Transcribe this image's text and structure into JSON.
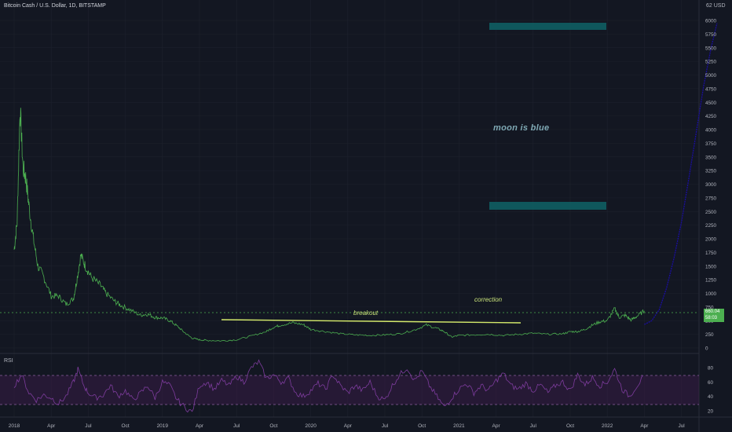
{
  "header": {
    "title": "Bitcoin Cash / U.S. Dollar, 1D, BITSTAMP",
    "currency": "USD",
    "currency_prefix": "62"
  },
  "indicator": {
    "label": "RSI"
  },
  "last_price": {
    "value": "660.04",
    "sub": "58:03"
  },
  "notes": {
    "moon": "moon is blue",
    "breakout": "breakout",
    "correction": "correction"
  },
  "colors": {
    "background": "#131722",
    "price": "#4caf50",
    "rsi": "#7e3c9e",
    "projection": "#1a0ea0",
    "trendline": "#d4ea6b",
    "target_box": "#0f5e63"
  },
  "chart_data": [
    {
      "type": "line",
      "name": "price",
      "x_ticks": [
        "2018",
        "Apr",
        "Jul",
        "Oct",
        "2019",
        "Apr",
        "Jul",
        "Oct",
        "2020",
        "Apr",
        "Jul",
        "Oct",
        "2021",
        "Apr",
        "Jul",
        "Oct",
        "2022",
        "Apr",
        "Jul"
      ],
      "y_ticks": [
        "6000",
        "5750",
        "5500",
        "5250",
        "5000",
        "4750",
        "4500",
        "4250",
        "4000",
        "3750",
        "3500",
        "3250",
        "3000",
        "2750",
        "2500",
        "2250",
        "2000",
        "1750",
        "1500",
        "1250",
        "1000",
        "750",
        "500",
        "250",
        "0"
      ],
      "ylim": [
        0,
        6200
      ],
      "series": [
        {
          "values": [
            [
              0,
              1800
            ],
            [
              0.02,
              2300
            ],
            [
              0.04,
              4400
            ],
            [
              0.06,
              3300
            ],
            [
              0.08,
              3100
            ],
            [
              0.1,
              2600
            ],
            [
              0.13,
              2000
            ],
            [
              0.16,
              1500
            ],
            [
              0.2,
              1300
            ],
            [
              0.25,
              950
            ],
            [
              0.3,
              950
            ],
            [
              0.35,
              800
            ],
            [
              0.4,
              900
            ],
            [
              0.42,
              1200
            ],
            [
              0.45,
              1700
            ],
            [
              0.48,
              1500
            ],
            [
              0.52,
              1300
            ],
            [
              0.58,
              1150
            ],
            [
              0.62,
              1000
            ],
            [
              0.68,
              850
            ],
            [
              0.72,
              780
            ],
            [
              0.78,
              700
            ],
            [
              0.85,
              600
            ],
            [
              0.9,
              620
            ],
            [
              0.95,
              560
            ],
            [
              1.0,
              550
            ],
            [
              1.05,
              500
            ],
            [
              1.1,
              400
            ],
            [
              1.15,
              280
            ],
            [
              1.2,
              180
            ],
            [
              1.25,
              150
            ],
            [
              1.3,
              140
            ],
            [
              1.4,
              130
            ],
            [
              1.5,
              150
            ],
            [
              1.6,
              220
            ],
            [
              1.7,
              300
            ],
            [
              1.75,
              380
            ],
            [
              1.8,
              420
            ],
            [
              1.88,
              460
            ],
            [
              1.95,
              430
            ],
            [
              2.0,
              340
            ],
            [
              2.1,
              300
            ],
            [
              2.2,
              260
            ],
            [
              2.3,
              240
            ],
            [
              2.4,
              230
            ],
            [
              2.5,
              240
            ],
            [
              2.6,
              260
            ],
            [
              2.7,
              330
            ],
            [
              2.78,
              420
            ],
            [
              2.85,
              360
            ],
            [
              2.9,
              300
            ],
            [
              2.95,
              200
            ],
            [
              3.0,
              230
            ],
            [
              3.1,
              240
            ],
            [
              3.2,
              250
            ],
            [
              3.3,
              230
            ],
            [
              3.4,
              250
            ],
            [
              3.5,
              270
            ],
            [
              3.6,
              250
            ],
            [
              3.7,
              260
            ],
            [
              3.75,
              300
            ],
            [
              3.8,
              300
            ],
            [
              3.85,
              340
            ],
            [
              3.9,
              420
            ],
            [
              3.95,
              480
            ],
            [
              4.0,
              500
            ],
            [
              4.05,
              720
            ],
            [
              4.08,
              560
            ],
            [
              4.12,
              600
            ],
            [
              4.16,
              510
            ],
            [
              4.2,
              580
            ],
            [
              4.25,
              680
            ]
          ]
        }
      ]
    },
    {
      "type": "line",
      "name": "projection",
      "series": [
        {
          "values": [
            [
              4.25,
              430
            ],
            [
              4.3,
              500
            ],
            [
              4.35,
              700
            ],
            [
              4.4,
              1100
            ],
            [
              4.45,
              1650
            ],
            [
              4.5,
              2300
            ],
            [
              4.55,
              3100
            ],
            [
              4.6,
              3950
            ],
            [
              4.65,
              4800
            ],
            [
              4.7,
              5500
            ],
            [
              4.74,
              5950
            ]
          ]
        }
      ]
    },
    {
      "type": "line",
      "name": "RSI",
      "y_ticks": [
        "80",
        "60",
        "40",
        "20"
      ],
      "ylim": [
        15,
        95
      ],
      "bands": [
        30,
        70
      ],
      "series": [
        {
          "values": [
            [
              0,
              55
            ],
            [
              0.05,
              70
            ],
            [
              0.1,
              45
            ],
            [
              0.15,
              35
            ],
            [
              0.2,
              42
            ],
            [
              0.25,
              38
            ],
            [
              0.3,
              30
            ],
            [
              0.35,
              40
            ],
            [
              0.4,
              60
            ],
            [
              0.43,
              78
            ],
            [
              0.47,
              55
            ],
            [
              0.5,
              45
            ],
            [
              0.55,
              38
            ],
            [
              0.6,
              42
            ],
            [
              0.65,
              55
            ],
            [
              0.7,
              40
            ],
            [
              0.75,
              48
            ],
            [
              0.8,
              35
            ],
            [
              0.85,
              44
            ],
            [
              0.9,
              55
            ],
            [
              0.95,
              38
            ],
            [
              1.0,
              60
            ],
            [
              1.05,
              55
            ],
            [
              1.1,
              35
            ],
            [
              1.15,
              25
            ],
            [
              1.2,
              18
            ],
            [
              1.25,
              55
            ],
            [
              1.3,
              60
            ],
            [
              1.35,
              50
            ],
            [
              1.4,
              62
            ],
            [
              1.45,
              55
            ],
            [
              1.5,
              68
            ],
            [
              1.55,
              60
            ],
            [
              1.6,
              80
            ],
            [
              1.65,
              88
            ],
            [
              1.7,
              65
            ],
            [
              1.75,
              70
            ],
            [
              1.8,
              60
            ],
            [
              1.85,
              65
            ],
            [
              1.9,
              45
            ],
            [
              1.95,
              40
            ],
            [
              2.0,
              48
            ],
            [
              2.05,
              58
            ],
            [
              2.1,
              50
            ],
            [
              2.15,
              70
            ],
            [
              2.2,
              55
            ],
            [
              2.25,
              45
            ],
            [
              2.3,
              55
            ],
            [
              2.35,
              48
            ],
            [
              2.4,
              60
            ],
            [
              2.45,
              40
            ],
            [
              2.5,
              35
            ],
            [
              2.55,
              55
            ],
            [
              2.6,
              70
            ],
            [
              2.65,
              80
            ],
            [
              2.7,
              62
            ],
            [
              2.75,
              75
            ],
            [
              2.8,
              55
            ],
            [
              2.85,
              40
            ],
            [
              2.9,
              25
            ],
            [
              2.95,
              38
            ],
            [
              3.0,
              50
            ],
            [
              3.05,
              58
            ],
            [
              3.1,
              45
            ],
            [
              3.15,
              55
            ],
            [
              3.2,
              48
            ],
            [
              3.25,
              62
            ],
            [
              3.3,
              72
            ],
            [
              3.35,
              55
            ],
            [
              3.4,
              50
            ],
            [
              3.45,
              58
            ],
            [
              3.5,
              48
            ],
            [
              3.55,
              56
            ],
            [
              3.6,
              45
            ],
            [
              3.65,
              55
            ],
            [
              3.7,
              60
            ],
            [
              3.75,
              48
            ],
            [
              3.8,
              70
            ],
            [
              3.85,
              56
            ],
            [
              3.9,
              66
            ],
            [
              3.95,
              55
            ],
            [
              4.0,
              60
            ],
            [
              4.05,
              78
            ],
            [
              4.1,
              50
            ],
            [
              4.15,
              40
            ],
            [
              4.2,
              55
            ],
            [
              4.25,
              68
            ]
          ]
        }
      ]
    }
  ]
}
